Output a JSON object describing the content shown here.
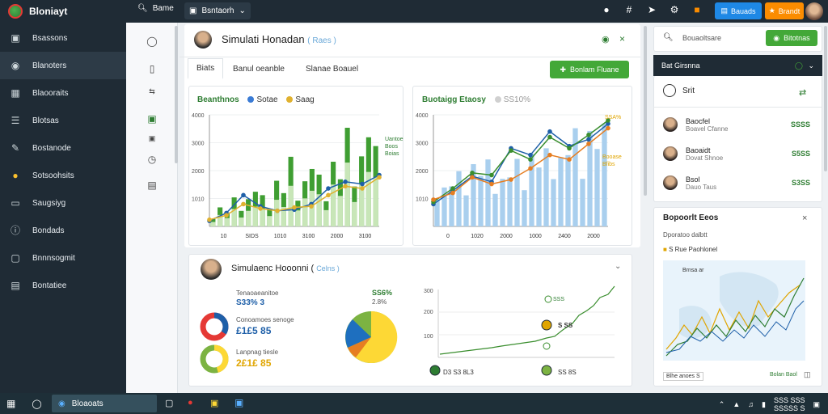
{
  "app": {
    "name": "Bloniayt"
  },
  "topbar": {
    "search_label": "Bame",
    "dropdown_label": "Bsntaorh",
    "btn_blue_label": "Bauads",
    "btn_orange_label": "Brandt"
  },
  "sidebar": {
    "items": [
      {
        "label": "Bsassons",
        "icon": "building-icon"
      },
      {
        "label": "Blanoters",
        "icon": "chart-icon"
      },
      {
        "label": "Blaooraits",
        "icon": "grid-icon"
      },
      {
        "label": "Blotsas",
        "icon": "list-icon"
      },
      {
        "label": "Bostanode",
        "icon": "pen-icon"
      },
      {
        "label": "Sotsoohsits",
        "icon": "coin-icon"
      },
      {
        "label": "Saugsiyg",
        "icon": "card-icon"
      },
      {
        "label": "Bondads",
        "icon": "info-icon"
      },
      {
        "label": "Bnnnsogmit",
        "icon": "lock-icon"
      },
      {
        "label": "Bontatiee",
        "icon": "table-icon"
      }
    ]
  },
  "header": {
    "title": "Simulati Honadan",
    "title_tag": "( Raes )"
  },
  "tabs": [
    {
      "label": "Biats"
    },
    {
      "label": "Banul oeanble"
    },
    {
      "label": "Slanae Boauel"
    }
  ],
  "main_button": {
    "label": "Bonlam Fluane"
  },
  "chart1": {
    "title": "Beanthnos",
    "legend": [
      {
        "label": "Sotae",
        "color": "#3a7bd5"
      },
      {
        "label": "Saag",
        "color": "#e0b12f"
      }
    ],
    "annotation": "Uantoe Boos Boias"
  },
  "chart2": {
    "title": "Buotaigg Etaosy",
    "legend_label": "SS10%",
    "annotation_top": "SSA%",
    "annotation_mid": "Booase Bfibs"
  },
  "summary": {
    "title": "Simulaenc Hooonni (",
    "title_tag": "Celns )",
    "stat1_label": "Tenaoaeanitoe",
    "stat1_value": "S33% 3",
    "stat2_label": "Conoamoes senoge",
    "stat2_value": "£1£5 85",
    "stat3_label": "Lanpnag tiesle",
    "stat3_value": "2£1£ 85",
    "pie_top": "SS6%",
    "pie_sub": "2.8%",
    "line_labels": [
      "SSS",
      "S SS"
    ],
    "line_legend": [
      "D3 S3 8L3",
      "SS 8S"
    ]
  },
  "right": {
    "search_placeholder": "Bouaoltsare",
    "search_btn": "Bitotnas",
    "dark_title": "Bat Girsnna",
    "counter_label": "Srit",
    "rows": [
      {
        "name": "Baocfel",
        "sub": "Boavel Cfanne",
        "value": "SSSS"
      },
      {
        "name": "Baoaidt",
        "sub": "Dovat Shnoe",
        "value": "S5SS"
      },
      {
        "name": "Bsol",
        "sub": "Dauo Taus",
        "value": "S3SS"
      }
    ],
    "map_title": "Bopoorlt Eeos",
    "map_sub": "Dporatoo dalbtt",
    "map_label": "S Rue Paohlonel",
    "map_inner": "Brnsa ar",
    "map_foot_left": "Blhe anoes S",
    "map_foot_right": "Bolan Baol"
  },
  "taskbar": {
    "active_app": "Bloaoats",
    "clock_top": "SSS SSS",
    "clock_bottom": "SSSSS S"
  },
  "chart_data": [
    {
      "type": "bar",
      "categories": [
        "10",
        "SIDS",
        "1010",
        "3100",
        "2000",
        "3100"
      ],
      "series": [
        {
          "name": "Sotae",
          "values": [
            20,
            35,
            48,
            58,
            68,
            90
          ]
        },
        {
          "name": "Saag",
          "values": [
            12,
            20,
            28,
            36,
            44,
            55
          ]
        }
      ],
      "ylim": [
        0,
        100
      ]
    },
    {
      "type": "bar",
      "categories": [
        "0",
        "1020",
        "2000",
        "1000",
        "2400",
        "2000"
      ],
      "series": [
        {
          "name": "",
          "values": [
            45,
            60,
            55,
            70,
            80,
            92
          ]
        }
      ],
      "ylim": [
        0,
        100
      ]
    }
  ]
}
